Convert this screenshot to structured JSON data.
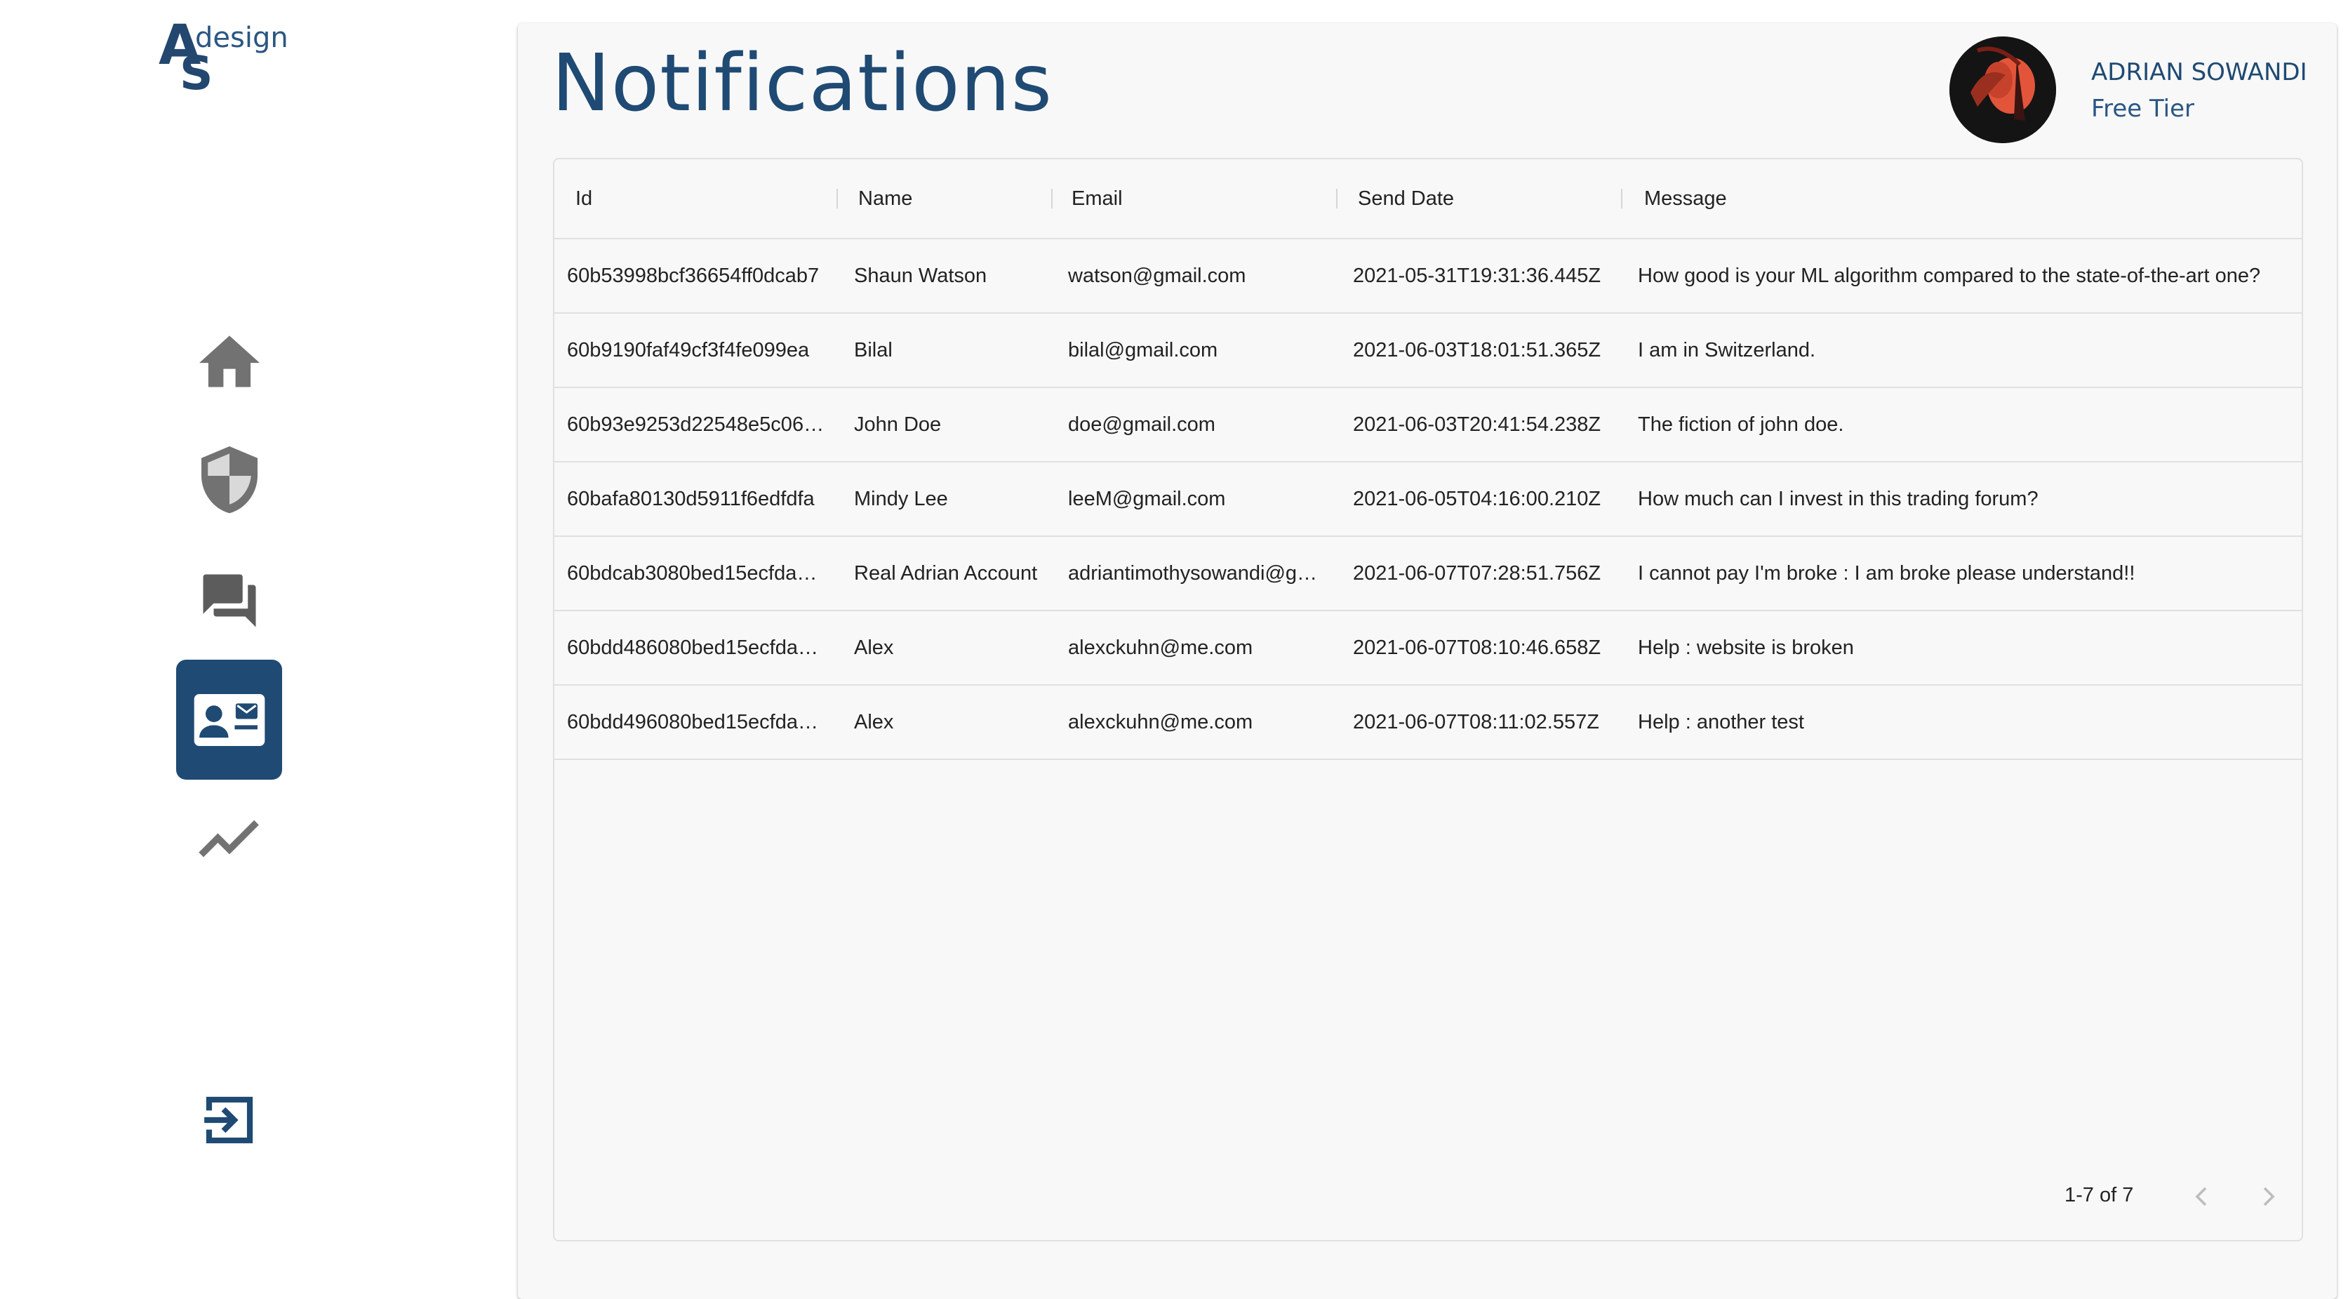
{
  "brand": {
    "logo_a": "A",
    "logo_s": "S",
    "logo_suffix": "design"
  },
  "sidebar": {
    "items": [
      {
        "name": "home",
        "icon": "home-icon",
        "active": false
      },
      {
        "name": "security",
        "icon": "shield-icon",
        "active": false
      },
      {
        "name": "forum",
        "icon": "chat-bubbles-icon",
        "active": false
      },
      {
        "name": "contact",
        "icon": "contact-card-icon",
        "active": true
      },
      {
        "name": "analytics",
        "icon": "trending-up-icon",
        "active": false
      }
    ],
    "logout_icon": "exit-icon"
  },
  "header": {
    "title": "Notifications"
  },
  "user": {
    "name": "ADRIAN SOWANDI",
    "tier": "Free Tier"
  },
  "table": {
    "columns": [
      "Id",
      "Name",
      "Email",
      "Send Date",
      "Message"
    ],
    "rows": [
      {
        "id": "60b53998bcf36654ff0dcab7",
        "name": "Shaun Watson",
        "email": "watson@gmail.com",
        "date": "2021-05-31T19:31:36.445Z",
        "message": "How good is your ML algorithm compared to the state-of-the-art one?"
      },
      {
        "id": "60b9190faf49cf3f4fe099ea",
        "name": "Bilal",
        "email": "bilal@gmail.com",
        "date": "2021-06-03T18:01:51.365Z",
        "message": "I am in Switzerland."
      },
      {
        "id": "60b93e9253d22548e5c06…",
        "name": "John Doe",
        "email": "doe@gmail.com",
        "date": "2021-06-03T20:41:54.238Z",
        "message": "The fiction of john doe."
      },
      {
        "id": "60bafa80130d5911f6edfdfa",
        "name": "Mindy Lee",
        "email": "leeM@gmail.com",
        "date": "2021-06-05T04:16:00.210Z",
        "message": "How much can I invest in this trading forum?"
      },
      {
        "id": "60bdcab3080bed15ecfda…",
        "name": "Real Adrian Account",
        "email": "adriantimothysowandi@g…",
        "date": "2021-06-07T07:28:51.756Z",
        "message": "I cannot pay I'm broke : I am broke please understand!!"
      },
      {
        "id": "60bdd486080bed15ecfda…",
        "name": "Alex",
        "email": "alexckuhn@me.com",
        "date": "2021-06-07T08:10:46.658Z",
        "message": "Help : website is broken"
      },
      {
        "id": "60bdd496080bed15ecfda…",
        "name": "Alex",
        "email": "alexckuhn@me.com",
        "date": "2021-06-07T08:11:02.557Z",
        "message": "Help : another test"
      }
    ],
    "pagination": "1-7 of 7"
  },
  "colors": {
    "primary": "#1f4a73",
    "icon_grey": "#6f6f6f",
    "card_bg": "#f8f8f8",
    "border": "#e0e0e0"
  }
}
